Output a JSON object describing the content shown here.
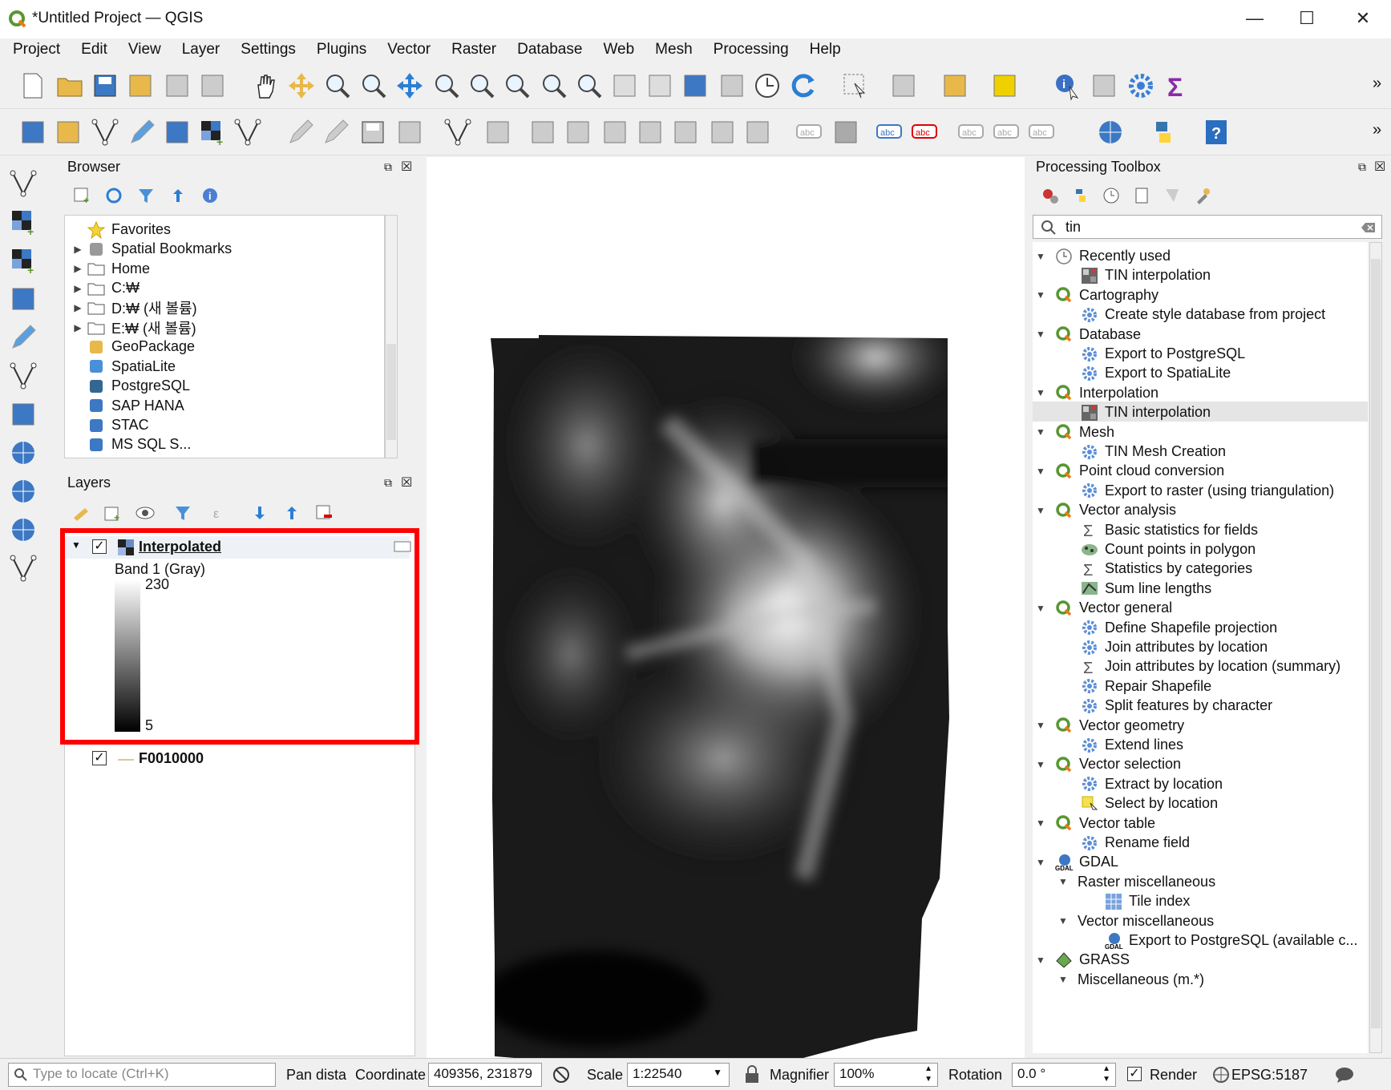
{
  "window": {
    "title": "*Untitled Project — QGIS",
    "minimize": "—",
    "maximize": "☐",
    "close": "✕"
  },
  "menu": [
    "Project",
    "Edit",
    "View",
    "Layer",
    "Settings",
    "Plugins",
    "Vector",
    "Raster",
    "Database",
    "Web",
    "Mesh",
    "Processing",
    "Help"
  ],
  "browser": {
    "title": "Browser",
    "items": [
      {
        "label": "Favorites",
        "icon": "star-icon",
        "expandable": false
      },
      {
        "label": "Spatial Bookmarks",
        "icon": "bookmark-icon",
        "expandable": true
      },
      {
        "label": "Home",
        "icon": "folder-icon",
        "expandable": true
      },
      {
        "label": "C:₩",
        "icon": "folder-icon",
        "expandable": true
      },
      {
        "label": "D:₩ (새 볼륨)",
        "icon": "folder-icon",
        "expandable": true
      },
      {
        "label": "E:₩ (새 볼륨)",
        "icon": "folder-icon",
        "expandable": true
      },
      {
        "label": "GeoPackage",
        "icon": "geopackage-icon",
        "expandable": false
      },
      {
        "label": "SpatiaLite",
        "icon": "feather-icon",
        "expandable": false
      },
      {
        "label": "PostgreSQL",
        "icon": "elephant-icon",
        "expandable": false
      },
      {
        "label": "SAP HANA",
        "icon": "hana-icon",
        "expandable": false
      },
      {
        "label": "STAC",
        "icon": "stac-icon",
        "expandable": false
      },
      {
        "label": "MS SQL S...",
        "icon": "mssql-icon",
        "expandable": false
      }
    ]
  },
  "layers": {
    "title": "Layers",
    "raster": {
      "name": "Interpolated",
      "band": "Band 1 (Gray)",
      "max": "230",
      "min": "5",
      "checked": "✓"
    },
    "vector": {
      "name": "F0010000",
      "checked": "✓"
    }
  },
  "toolbox": {
    "title": "Processing Toolbox",
    "search_value": "tin",
    "groups": [
      {
        "label": "Recently used",
        "icon": "clock-icon",
        "items": [
          {
            "label": "TIN interpolation",
            "icon": "tin-icon"
          }
        ]
      },
      {
        "label": "Cartography",
        "icon": "qgis-icon",
        "items": [
          {
            "label": "Create style database from project",
            "icon": "gear-icon"
          }
        ]
      },
      {
        "label": "Database",
        "icon": "qgis-icon",
        "items": [
          {
            "label": "Export to PostgreSQL",
            "icon": "gear-icon"
          },
          {
            "label": "Export to SpatiaLite",
            "icon": "gear-icon"
          }
        ]
      },
      {
        "label": "Interpolation",
        "icon": "qgis-icon",
        "items": [
          {
            "label": "TIN interpolation",
            "icon": "tin-icon",
            "selected": true
          }
        ]
      },
      {
        "label": "Mesh",
        "icon": "qgis-icon",
        "items": [
          {
            "label": "TIN Mesh Creation",
            "icon": "gear-icon"
          }
        ]
      },
      {
        "label": "Point cloud conversion",
        "icon": "qgis-icon",
        "items": [
          {
            "label": "Export to raster (using triangulation)",
            "icon": "gear-icon"
          }
        ]
      },
      {
        "label": "Vector analysis",
        "icon": "qgis-icon",
        "items": [
          {
            "label": "Basic statistics for fields",
            "icon": "sigma-icon"
          },
          {
            "label": "Count points in polygon",
            "icon": "points-icon"
          },
          {
            "label": "Statistics by categories",
            "icon": "sigma-icon"
          },
          {
            "label": "Sum line lengths",
            "icon": "lines-icon"
          }
        ]
      },
      {
        "label": "Vector general",
        "icon": "qgis-icon",
        "items": [
          {
            "label": "Define Shapefile projection",
            "icon": "gear-icon"
          },
          {
            "label": "Join attributes by location",
            "icon": "gear-icon"
          },
          {
            "label": "Join attributes by location (summary)",
            "icon": "sigma-icon"
          },
          {
            "label": "Repair Shapefile",
            "icon": "gear-icon"
          },
          {
            "label": "Split features by character",
            "icon": "gear-icon"
          }
        ]
      },
      {
        "label": "Vector geometry",
        "icon": "qgis-icon",
        "items": [
          {
            "label": "Extend lines",
            "icon": "gear-icon"
          }
        ]
      },
      {
        "label": "Vector selection",
        "icon": "qgis-icon",
        "items": [
          {
            "label": "Extract by location",
            "icon": "gear-icon"
          },
          {
            "label": "Select by location",
            "icon": "select-icon"
          }
        ]
      },
      {
        "label": "Vector table",
        "icon": "qgis-icon",
        "items": [
          {
            "label": "Rename field",
            "icon": "gear-icon"
          }
        ]
      },
      {
        "label": "GDAL",
        "icon": "gdal-icon",
        "subgroups": [
          {
            "label": "Raster miscellaneous",
            "items": [
              {
                "label": "Tile index",
                "icon": "grid-icon"
              }
            ]
          },
          {
            "label": "Vector miscellaneous",
            "items": [
              {
                "label": "Export to PostgreSQL (available c...",
                "icon": "gdal-icon"
              }
            ]
          }
        ]
      },
      {
        "label": "GRASS",
        "icon": "grass-icon",
        "subgroups": [
          {
            "label": "Miscellaneous (m.*)",
            "items": []
          }
        ]
      }
    ]
  },
  "statusbar": {
    "locate_placeholder": "Type to locate (Ctrl+K)",
    "pan_label": "Pan dista",
    "coord_label": "Coordinate",
    "coord_value": "409356, 231879",
    "scale_label": "Scale",
    "scale_value": "1:22540",
    "magnifier_label": "Magnifier",
    "magnifier_value": "100%",
    "rotation_label": "Rotation",
    "rotation_value": "0.0 °",
    "render_label": "Render",
    "crs": "EPSG:5187"
  },
  "colors": {
    "highlight_box": "#ff0000",
    "qgis_green": "#589632",
    "selected_row": "#e5e5e5"
  }
}
